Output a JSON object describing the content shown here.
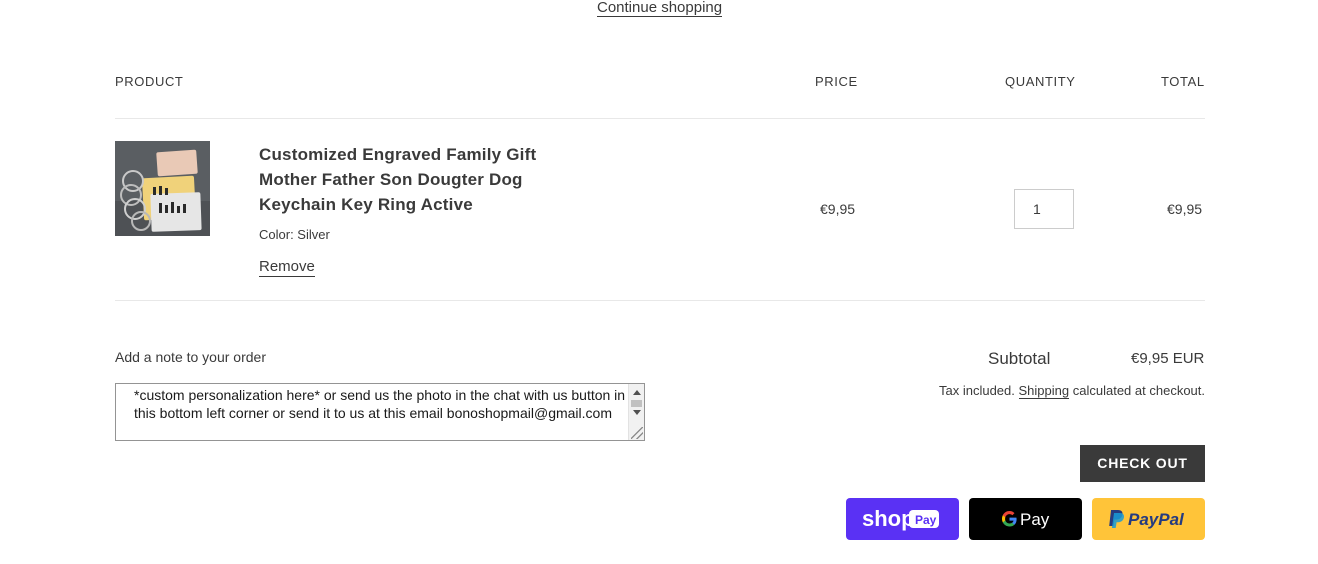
{
  "nav": {
    "continue_label": "Continue shopping"
  },
  "table": {
    "headers": {
      "product": "PRODUCT",
      "price": "PRICE",
      "quantity": "QUANTITY",
      "total": "TOTAL"
    }
  },
  "item": {
    "title_lines": [
      "Customized Engraved Family Gift",
      "Mother Father Son Dougter Dog",
      "Keychain Key Ring Active"
    ],
    "variant": "Color: Silver",
    "remove_label": "Remove",
    "price": "€9,95",
    "quantity": "1",
    "total": "€9,95"
  },
  "note": {
    "label": "Add a note to your order",
    "value": "*custom personalization here* or send us the photo in the chat with us button in this bottom left corner or send it to us at this email bonoshopmail@gmail.com"
  },
  "summary": {
    "subtotal_label": "Subtotal",
    "subtotal_value": "€9,95 EUR",
    "tax_prefix": "Tax included.",
    "tax_link": "Shipping",
    "tax_suffix": "calculated at checkout.",
    "checkout_label": "CHECK OUT"
  },
  "payments": {
    "shop_text": "shop",
    "shop_badge": "Pay",
    "gpay_text": "Pay",
    "paypal_text": "PayPal"
  },
  "colors": {
    "shop_pay": "#5a31f4",
    "google_pay": "#000000",
    "paypal": "#ffc439",
    "checkout": "#3a3a3a"
  }
}
